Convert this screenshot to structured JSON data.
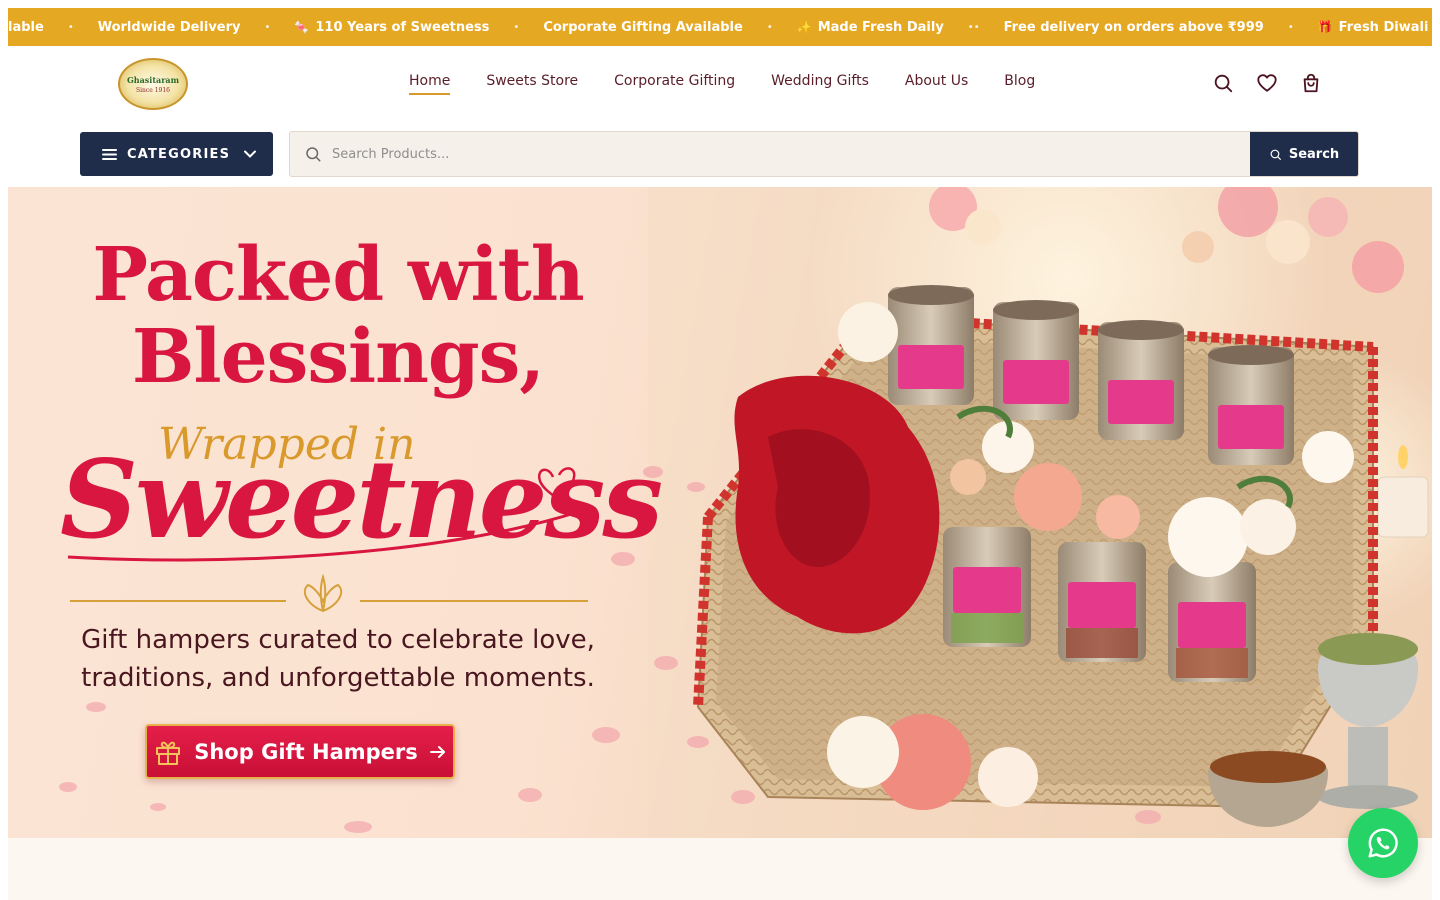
{
  "marquee": {
    "items": [
      {
        "icon": "",
        "text": "lable"
      },
      {
        "icon": "",
        "text": "Worldwide Delivery"
      },
      {
        "icon": "🍬",
        "text": "110 Years of Sweetness"
      },
      {
        "icon": "",
        "text": "Corporate Gifting Available"
      },
      {
        "icon": "✨",
        "text": "Made Fresh Daily"
      },
      {
        "icon": "",
        "text": "Free delivery on orders above ₹999"
      },
      {
        "icon": "🎁",
        "text": "Fresh Diwali Hampers Now Av"
      }
    ],
    "colors": {
      "background": "#e5a823"
    }
  },
  "header": {
    "logo": {
      "name": "Ghasitaram",
      "tagline": "Since 1916"
    },
    "nav": [
      {
        "label": "Home",
        "active": true
      },
      {
        "label": "Sweets Store",
        "active": false
      },
      {
        "label": "Corporate Gifting",
        "active": false
      },
      {
        "label": "Wedding Gifts",
        "active": false
      },
      {
        "label": "About Us",
        "active": false
      },
      {
        "label": "Blog",
        "active": false
      }
    ],
    "icons": [
      "search-icon",
      "heart-icon",
      "shopping-bag-icon"
    ]
  },
  "search": {
    "categories_label": "CATEGORIES",
    "placeholder": "Search Products...",
    "button_label": "Search"
  },
  "hero": {
    "title_line1": "Packed with",
    "title_line2": "Blessings,",
    "title_line3": "Wrapped in",
    "title_line4": "Sweetness",
    "subtitle": "Gift hampers curated to celebrate love, traditions, and unforgettable moments.",
    "cta_label": "Shop Gift Hampers",
    "colors": {
      "title": "#d8163f",
      "accent_gold": "#d9992b",
      "text": "#4a1620"
    }
  },
  "floating": {
    "whatsapp_icon": "whatsapp-icon"
  },
  "colors": {
    "navy": "#1f2d4a",
    "gold": "#e5a823",
    "brand_red": "#d8163f",
    "whatsapp_green": "#25d366"
  }
}
